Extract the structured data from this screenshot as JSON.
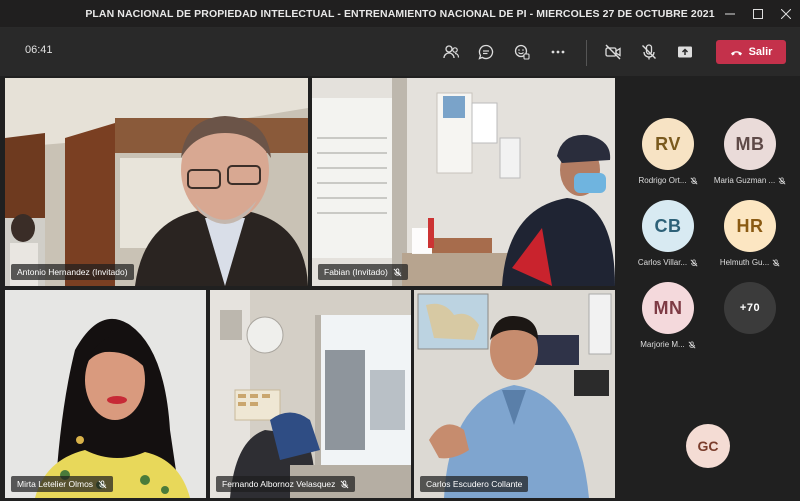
{
  "window": {
    "title": "PLAN NACIONAL DE PROPIEDAD INTELECTUAL - ENTRENAMIENTO NACIONAL DE PI - MIERCOLES 27 DE OCTUBRE 2021"
  },
  "toolbar": {
    "timer": "06:41",
    "leave_label": "Salir",
    "colors": {
      "leave": "#c4314b"
    },
    "icons": [
      "people-icon",
      "chat-icon",
      "reactions-icon",
      "more-icon",
      "camera-off-icon",
      "mic-off-icon",
      "share-icon",
      "phone-icon"
    ]
  },
  "video_tiles": [
    {
      "name": "Antonio Hernandez (Invitado)",
      "muted": false
    },
    {
      "name": "Fabian (Invitado)",
      "muted": true
    },
    {
      "name": "Mirta Letelier Olmos",
      "muted": true
    },
    {
      "name": "Fernando Albornoz Velasquez",
      "muted": true
    },
    {
      "name": "Carlos Escudero Collante",
      "muted": false,
      "active_speaker": true
    }
  ],
  "roster": {
    "people": [
      {
        "initials": "RV",
        "name": "Rodrigo Ort...",
        "muted": true
      },
      {
        "initials": "MB",
        "name": "Maria Guzman ...",
        "muted": true
      },
      {
        "initials": "CB",
        "name": "Carlos Villar...",
        "muted": true
      },
      {
        "initials": "HR",
        "name": "Helmuth Gu...",
        "muted": true
      },
      {
        "initials": "MN",
        "name": "Marjorie M...",
        "muted": true
      }
    ],
    "overflow_count": "+70",
    "self_initials": "GC",
    "colors": {
      "RV": "#f7e3c4",
      "MB": "#eadbd9",
      "CB": "#d8eaf2",
      "HR": "#fce6c2",
      "MN": "#f4d9dc",
      "GC": "#f4dcd4",
      "RV_text": "#7a5a1e",
      "MB_text": "#5f4a48",
      "CB_text": "#2d6178",
      "HR_text": "#8a5a12",
      "MN_text": "#7d3a44",
      "GC_text": "#7a3d2c"
    }
  }
}
